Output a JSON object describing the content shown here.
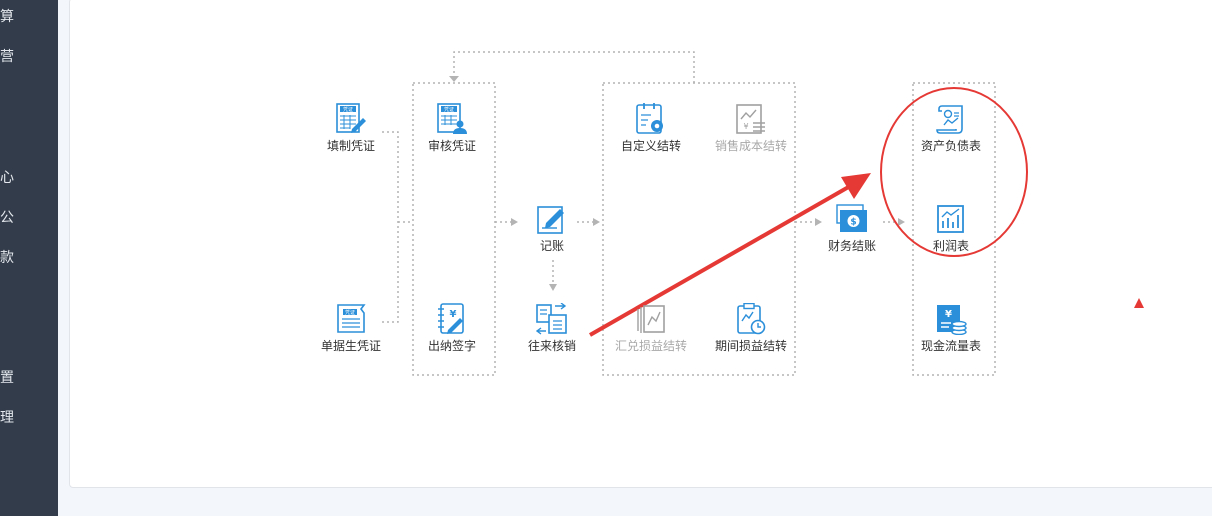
{
  "sidebar": {
    "items": [
      "算",
      "营",
      "心",
      "公",
      "款",
      "置",
      "理"
    ]
  },
  "flow": {
    "nodes": {
      "fill_voucher": "填制凭证",
      "review_voucher": "审核凭证",
      "doc_voucher": "单据生凭证",
      "cashier_sign": "出纳签字",
      "bookkeeping": "记账",
      "account_writeoff": "往来核销",
      "custom_transfer": "自定义结转",
      "sales_cost_transfer": "销售成本结转",
      "fx_gain_loss_transfer": "汇兑损益结转",
      "period_gain_loss_transfer": "期间损益结转",
      "financial_close": "财务结账",
      "balance_sheet": "资产负债表",
      "income_statement": "利润表",
      "cash_flow_statement": "现金流量表"
    },
    "icon_badges": {
      "voucher": "凭证",
      "yuan": "¥"
    }
  },
  "colors": {
    "icon_blue": "#2b8fd9",
    "icon_gray": "#a0a0a0",
    "annotation_red": "#e53935",
    "connector_gray": "#b4b4b4"
  }
}
